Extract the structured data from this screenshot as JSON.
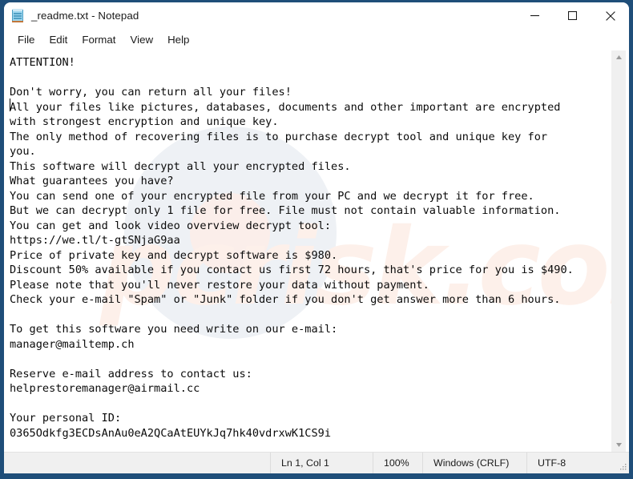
{
  "window": {
    "title": "_readme.txt - Notepad",
    "app_icon": "notepad-icon",
    "controls": {
      "minimize": "minimize-icon",
      "maximize": "maximize-icon",
      "close": "close-icon"
    }
  },
  "menu": {
    "items": [
      {
        "label": "File"
      },
      {
        "label": "Edit"
      },
      {
        "label": "Format"
      },
      {
        "label": "View"
      },
      {
        "label": "Help"
      }
    ]
  },
  "editor": {
    "content": "ATTENTION!\n\nDon't worry, you can return all your files!\nAll your files like pictures, databases, documents and other important are encrypted\nwith strongest encryption and unique key.\nThe only method of recovering files is to purchase decrypt tool and unique key for\nyou.\nThis software will decrypt all your encrypted files.\nWhat guarantees you have?\nYou can send one of your encrypted file from your PC and we decrypt it for free.\nBut we can decrypt only 1 file for free. File must not contain valuable information.\nYou can get and look video overview decrypt tool:\nhttps://we.tl/t-gtSNjaG9aa\nPrice of private key and decrypt software is $980.\nDiscount 50% available if you contact us first 72 hours, that's price for you is $490.\nPlease note that you'll never restore your data without payment.\nCheck your e-mail \"Spam\" or \"Junk\" folder if you don't get answer more than 6 hours.\n\nTo get this software you need write on our e-mail:\nmanager@mailtemp.ch\n\nReserve e-mail address to contact us:\nhelprestoremanager@airmail.cc\n\nYour personal ID:\n0365Odkfg3ECDsAnAu0eA2QCaAtEUYkJq7hk40vdrxwK1CS9i",
    "watermark": "pcrisk.com"
  },
  "scrollbar": {
    "up_arrow": "scroll-up-arrow-icon",
    "down_arrow": "scroll-down-arrow-icon"
  },
  "statusbar": {
    "line_col": "Ln 1, Col 1",
    "zoom": "100%",
    "line_ending": "Windows (CRLF)",
    "encoding": "UTF-8"
  },
  "colors": {
    "window_border": "#1f4e79",
    "titlebar_bg": "#ffffff",
    "statusbar_bg": "#f0f0f0",
    "text": "#0b0b0b"
  }
}
